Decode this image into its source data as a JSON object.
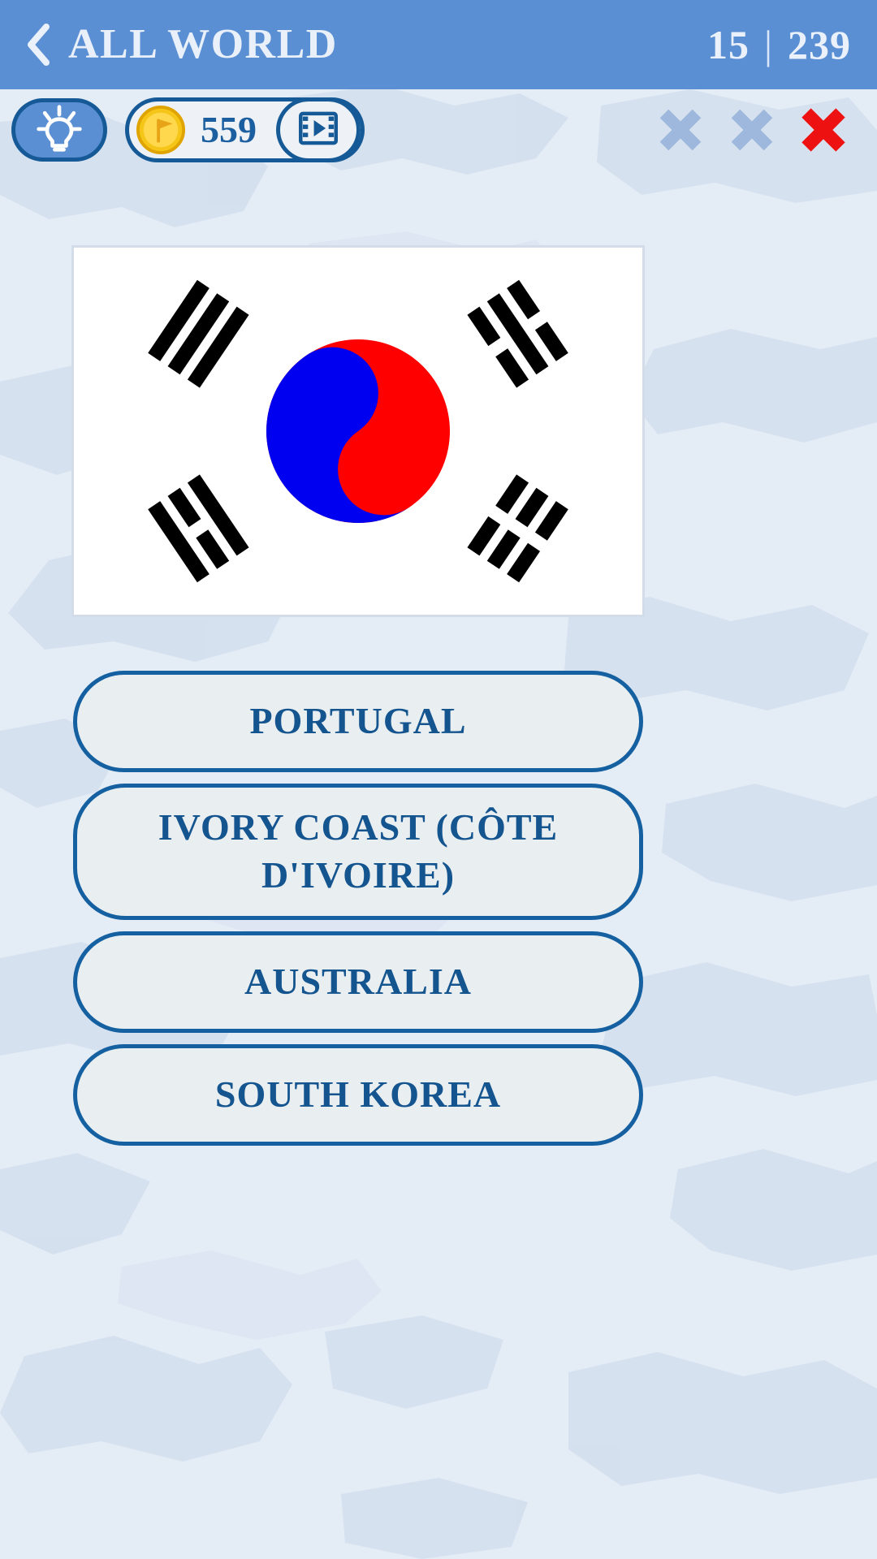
{
  "header": {
    "back_icon": "back-chevron-icon",
    "title": "ALL WORLD",
    "current_question": "15",
    "separator": "|",
    "total_questions": "239"
  },
  "toolbar": {
    "hint_icon": "lightbulb-icon",
    "coin_icon": "gold-coin-flag-icon",
    "coin_count": "559",
    "video_icon": "video-film-icon",
    "lives": [
      {
        "name": "life-x-1",
        "state": "available",
        "color": "#9db8dc"
      },
      {
        "name": "life-x-2",
        "state": "available",
        "color": "#9db8dc"
      },
      {
        "name": "life-x-3",
        "state": "lost",
        "color": "#ee1111"
      }
    ]
  },
  "flag": {
    "name": "south-korea-flag",
    "field_color": "#ffffff",
    "taeguk_red": "#ff0000",
    "taeguk_blue": "#0000f0",
    "trigram_color": "#000000"
  },
  "answers": [
    {
      "label": "PORTUGAL",
      "lines": 1
    },
    {
      "label": "IVORY COAST (CÔTE D'IVOIRE)",
      "lines": 2
    },
    {
      "label": "AUSTRALIA",
      "lines": 1
    },
    {
      "label": "SOUTH KOREA",
      "lines": 1
    }
  ],
  "theme": {
    "header_blue": "#5b8fd4",
    "page_bg": "#e4ecf6",
    "border_blue": "#1560a0",
    "text_blue": "#14548f",
    "coin_gold": "#f5c518"
  }
}
